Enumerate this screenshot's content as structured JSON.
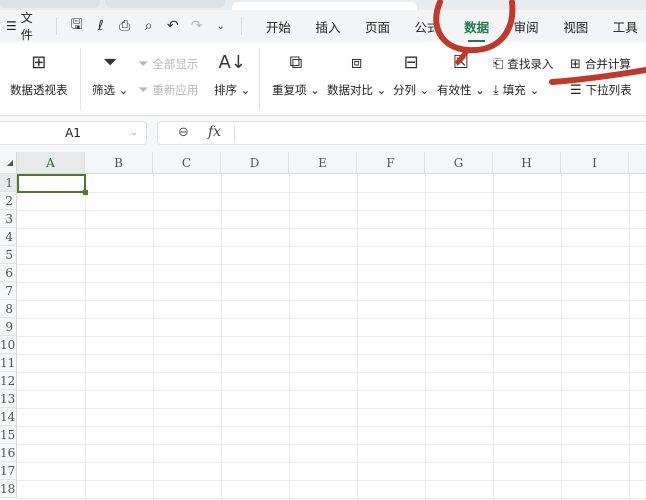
{
  "menubar": {
    "menu_icon": "hamburger-icon",
    "file_label": "文件",
    "quick_access": [
      "save-icon",
      "link-icon",
      "print-icon",
      "print-preview-icon",
      "undo-icon",
      "redo-icon",
      "more-icon"
    ],
    "tabs": [
      "开始",
      "插入",
      "页面",
      "公式",
      "数据",
      "审阅",
      "视图",
      "工具"
    ],
    "active_tab": "数据"
  },
  "ribbon": {
    "pivot": "数据透视表",
    "filter": "筛选",
    "show_all": "全部显示",
    "reapply": "重新应用",
    "sort": "排序",
    "duplicates": "重复项",
    "compare": "数据对比",
    "split": "分列",
    "validation": "有效性",
    "lookup_entry": "查找录入",
    "fill": "填充",
    "consolidate": "合并计算",
    "dropdown_list": "下拉列表"
  },
  "formula_bar": {
    "name_box": "A1",
    "fx": "fx",
    "value": ""
  },
  "grid": {
    "columns": [
      "A",
      "B",
      "C",
      "D",
      "E",
      "F",
      "G",
      "H",
      "I"
    ],
    "rows": [
      "1",
      "2",
      "3",
      "4",
      "5",
      "6",
      "7",
      "8",
      "9",
      "10",
      "11",
      "12",
      "13",
      "14",
      "15",
      "16",
      "17",
      "18"
    ],
    "selected_cell": "A1"
  },
  "annotation_color": "#c0392b"
}
